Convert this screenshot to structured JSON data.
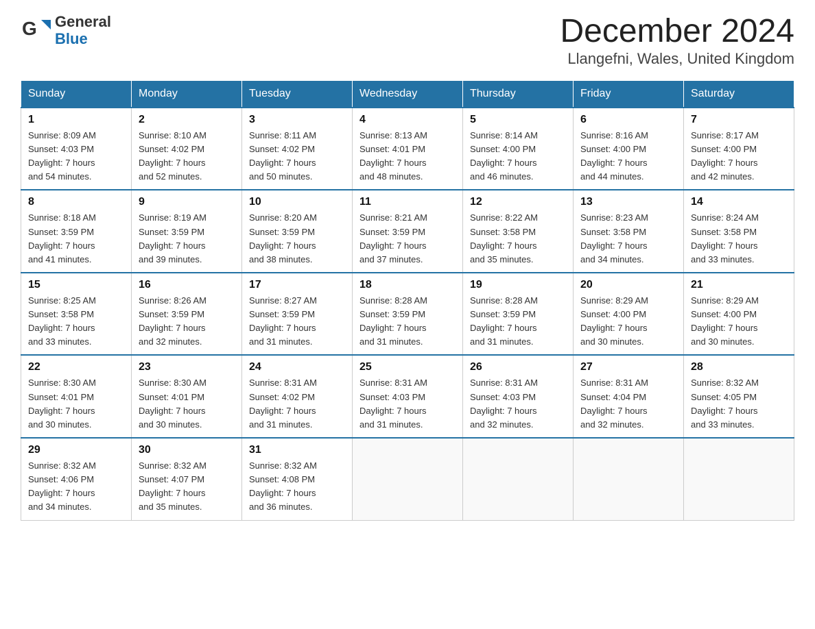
{
  "header": {
    "title": "December 2024",
    "subtitle": "Llangefni, Wales, United Kingdom",
    "logo_line1": "General",
    "logo_line2": "Blue"
  },
  "days_of_week": [
    "Sunday",
    "Monday",
    "Tuesday",
    "Wednesday",
    "Thursday",
    "Friday",
    "Saturday"
  ],
  "weeks": [
    [
      {
        "day": "1",
        "sunrise": "8:09 AM",
        "sunset": "4:03 PM",
        "daylight": "7 hours and 54 minutes."
      },
      {
        "day": "2",
        "sunrise": "8:10 AM",
        "sunset": "4:02 PM",
        "daylight": "7 hours and 52 minutes."
      },
      {
        "day": "3",
        "sunrise": "8:11 AM",
        "sunset": "4:02 PM",
        "daylight": "7 hours and 50 minutes."
      },
      {
        "day": "4",
        "sunrise": "8:13 AM",
        "sunset": "4:01 PM",
        "daylight": "7 hours and 48 minutes."
      },
      {
        "day": "5",
        "sunrise": "8:14 AM",
        "sunset": "4:00 PM",
        "daylight": "7 hours and 46 minutes."
      },
      {
        "day": "6",
        "sunrise": "8:16 AM",
        "sunset": "4:00 PM",
        "daylight": "7 hours and 44 minutes."
      },
      {
        "day": "7",
        "sunrise": "8:17 AM",
        "sunset": "4:00 PM",
        "daylight": "7 hours and 42 minutes."
      }
    ],
    [
      {
        "day": "8",
        "sunrise": "8:18 AM",
        "sunset": "3:59 PM",
        "daylight": "7 hours and 41 minutes."
      },
      {
        "day": "9",
        "sunrise": "8:19 AM",
        "sunset": "3:59 PM",
        "daylight": "7 hours and 39 minutes."
      },
      {
        "day": "10",
        "sunrise": "8:20 AM",
        "sunset": "3:59 PM",
        "daylight": "7 hours and 38 minutes."
      },
      {
        "day": "11",
        "sunrise": "8:21 AM",
        "sunset": "3:59 PM",
        "daylight": "7 hours and 37 minutes."
      },
      {
        "day": "12",
        "sunrise": "8:22 AM",
        "sunset": "3:58 PM",
        "daylight": "7 hours and 35 minutes."
      },
      {
        "day": "13",
        "sunrise": "8:23 AM",
        "sunset": "3:58 PM",
        "daylight": "7 hours and 34 minutes."
      },
      {
        "day": "14",
        "sunrise": "8:24 AM",
        "sunset": "3:58 PM",
        "daylight": "7 hours and 33 minutes."
      }
    ],
    [
      {
        "day": "15",
        "sunrise": "8:25 AM",
        "sunset": "3:58 PM",
        "daylight": "7 hours and 33 minutes."
      },
      {
        "day": "16",
        "sunrise": "8:26 AM",
        "sunset": "3:59 PM",
        "daylight": "7 hours and 32 minutes."
      },
      {
        "day": "17",
        "sunrise": "8:27 AM",
        "sunset": "3:59 PM",
        "daylight": "7 hours and 31 minutes."
      },
      {
        "day": "18",
        "sunrise": "8:28 AM",
        "sunset": "3:59 PM",
        "daylight": "7 hours and 31 minutes."
      },
      {
        "day": "19",
        "sunrise": "8:28 AM",
        "sunset": "3:59 PM",
        "daylight": "7 hours and 31 minutes."
      },
      {
        "day": "20",
        "sunrise": "8:29 AM",
        "sunset": "4:00 PM",
        "daylight": "7 hours and 30 minutes."
      },
      {
        "day": "21",
        "sunrise": "8:29 AM",
        "sunset": "4:00 PM",
        "daylight": "7 hours and 30 minutes."
      }
    ],
    [
      {
        "day": "22",
        "sunrise": "8:30 AM",
        "sunset": "4:01 PM",
        "daylight": "7 hours and 30 minutes."
      },
      {
        "day": "23",
        "sunrise": "8:30 AM",
        "sunset": "4:01 PM",
        "daylight": "7 hours and 30 minutes."
      },
      {
        "day": "24",
        "sunrise": "8:31 AM",
        "sunset": "4:02 PM",
        "daylight": "7 hours and 31 minutes."
      },
      {
        "day": "25",
        "sunrise": "8:31 AM",
        "sunset": "4:03 PM",
        "daylight": "7 hours and 31 minutes."
      },
      {
        "day": "26",
        "sunrise": "8:31 AM",
        "sunset": "4:03 PM",
        "daylight": "7 hours and 32 minutes."
      },
      {
        "day": "27",
        "sunrise": "8:31 AM",
        "sunset": "4:04 PM",
        "daylight": "7 hours and 32 minutes."
      },
      {
        "day": "28",
        "sunrise": "8:32 AM",
        "sunset": "4:05 PM",
        "daylight": "7 hours and 33 minutes."
      }
    ],
    [
      {
        "day": "29",
        "sunrise": "8:32 AM",
        "sunset": "4:06 PM",
        "daylight": "7 hours and 34 minutes."
      },
      {
        "day": "30",
        "sunrise": "8:32 AM",
        "sunset": "4:07 PM",
        "daylight": "7 hours and 35 minutes."
      },
      {
        "day": "31",
        "sunrise": "8:32 AM",
        "sunset": "4:08 PM",
        "daylight": "7 hours and 36 minutes."
      },
      null,
      null,
      null,
      null
    ]
  ],
  "labels": {
    "sunrise": "Sunrise:",
    "sunset": "Sunset:",
    "daylight": "Daylight:"
  }
}
